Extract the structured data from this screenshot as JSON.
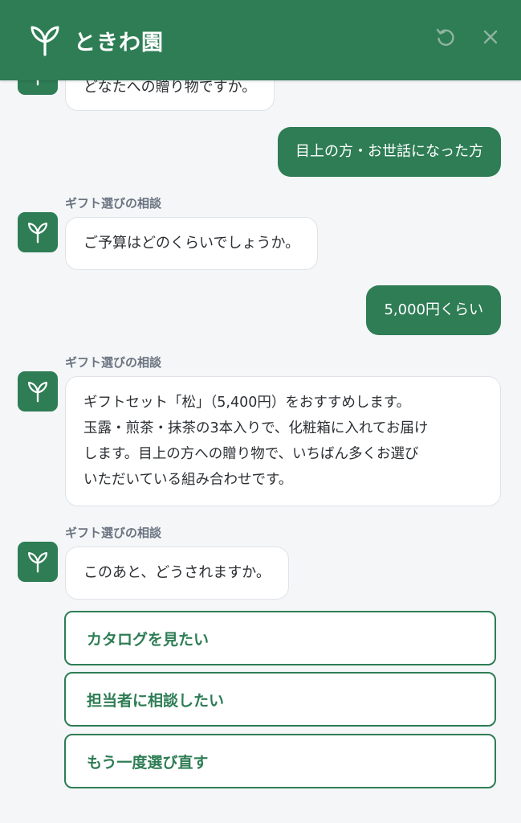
{
  "header": {
    "brand_name": "ときわ園",
    "brand_icon": "sprout-icon",
    "reload_icon": "reload-icon",
    "close_icon": "close-icon",
    "color": "#2e7d55"
  },
  "messages": {
    "bot_0_text": "どなたへの贈り物ですか。",
    "user_1_text": "目上の方・お世話になった方",
    "sender_label": "ギフト選びの相談",
    "bot_2_text": "ご予算はどのくらいでしょうか。",
    "user_3_text": "5,000円くらい",
    "bot_4_lines": [
      "ギフトセット「松」（5,400円）をおすすめします。",
      "玉露・煎茶・抹茶の3本入りで、化粧箱に入れてお届け",
      "します。目上の方への贈り物で、いちばん多くお選び",
      "いただいている組み合わせです。"
    ],
    "bot_5_text": "このあと、どうされますか。"
  },
  "options": [
    "カタログを見たい",
    "担当者に相談したい",
    "もう一度選び直す"
  ]
}
